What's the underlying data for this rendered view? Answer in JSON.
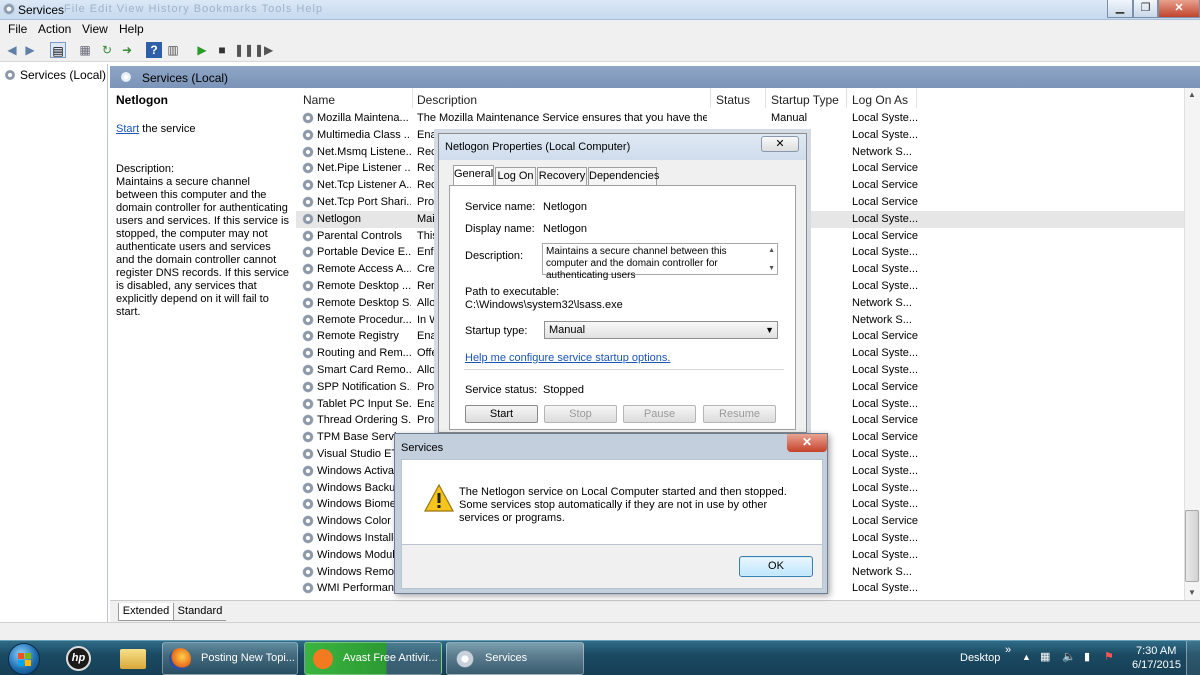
{
  "window": {
    "title": "Services",
    "ghost_menu": "File  Edit  View  History  Bookmarks  Tools  Help",
    "min": "▁",
    "max": "❐",
    "close": "✕"
  },
  "menu": [
    "File",
    "Action",
    "View",
    "Help"
  ],
  "tree": {
    "root": "Services (Local)"
  },
  "header": {
    "title": "Services (Local)"
  },
  "left_pane": {
    "service_name": "Netlogon",
    "start_link": "Start",
    "start_suffix": " the service",
    "desc_label": "Description:",
    "desc_text": "Maintains a secure channel between this computer and the domain controller for authenticating users and services. If this service is stopped, the computer may not authenticate users and services and the domain controller cannot register DNS records. If this service is disabled, any services that explicitly depend on it will fail to start."
  },
  "columns": {
    "name": "Name",
    "description": "Description",
    "status": "Status",
    "startup": "Startup Type",
    "logon": "Log On As"
  },
  "rows": [
    {
      "name": "Mozilla Maintena...",
      "desc": "The Mozilla Maintenance Service ensures that you have the l...",
      "status": "",
      "logon": "Local Syste...",
      "startup": "Manual"
    },
    {
      "name": "Multimedia Class ...",
      "desc": "Enab",
      "status": "",
      "logon": "Local Syste..."
    },
    {
      "name": "Net.Msmq Listene...",
      "desc": "Rece",
      "status": "",
      "logon": "Network S..."
    },
    {
      "name": "Net.Pipe Listener ...",
      "desc": "Rece",
      "status": "",
      "logon": "Local Service"
    },
    {
      "name": "Net.Tcp Listener A...",
      "desc": "Rece",
      "status": "",
      "logon": "Local Service"
    },
    {
      "name": "Net.Tcp Port Shari...",
      "desc": "Prov",
      "status": "",
      "logon": "Local Service"
    },
    {
      "name": "Netlogon",
      "desc": "Main",
      "status": "",
      "logon": "Local Syste...",
      "selected": true
    },
    {
      "name": "Parental Controls",
      "desc": "This",
      "status": "",
      "logon": "Local Service"
    },
    {
      "name": "Portable Device E...",
      "desc": "Enfo",
      "status": "",
      "logon": "Local Syste..."
    },
    {
      "name": "Remote Access A...",
      "desc": "Crea",
      "status": "",
      "logon": "Local Syste..."
    },
    {
      "name": "Remote Desktop ...",
      "desc": "Rem",
      "status": "",
      "logon": "Local Syste..."
    },
    {
      "name": "Remote Desktop S...",
      "desc": "Allo",
      "status": "",
      "logon": "Network S..."
    },
    {
      "name": "Remote Procedur...",
      "desc": "In W",
      "status": "",
      "logon": "Network S..."
    },
    {
      "name": "Remote Registry",
      "desc": "Enab",
      "status": "",
      "logon": "Local Service"
    },
    {
      "name": "Routing and Rem...",
      "desc": "Offe",
      "status": "",
      "logon": "Local Syste..."
    },
    {
      "name": "Smart Card Remo...",
      "desc": "Allo",
      "status": "",
      "logon": "Local Syste..."
    },
    {
      "name": "SPP Notification S...",
      "desc": "Prov",
      "status": "",
      "logon": "Local Service"
    },
    {
      "name": "Tablet PC Input Se...",
      "desc": "Enab",
      "status": "",
      "logon": "Local Syste..."
    },
    {
      "name": "Thread Ordering S...",
      "desc": "Prov",
      "status": "",
      "logon": "Local Service"
    },
    {
      "name": "TPM Base Service",
      "desc": "",
      "status": "",
      "logon": "Local Service"
    },
    {
      "name": "Visual Studio ETW",
      "desc": "",
      "status": "",
      "logon": "Local Syste..."
    },
    {
      "name": "Windows Activat",
      "desc": "",
      "status": "",
      "logon": "Local Syste..."
    },
    {
      "name": "Windows Backup",
      "desc": "",
      "status": "",
      "logon": "Local Syste..."
    },
    {
      "name": "Windows Biome",
      "desc": "",
      "status": "",
      "logon": "Local Syste..."
    },
    {
      "name": "Windows Color S",
      "desc": "",
      "status": "",
      "logon": "Local Service"
    },
    {
      "name": "Windows Installe",
      "desc": "",
      "status": "",
      "logon": "Local Syste..."
    },
    {
      "name": "Windows Modul",
      "desc": "",
      "status": "",
      "logon": "Local Syste..."
    },
    {
      "name": "Windows Remot",
      "desc": "",
      "status": "",
      "logon": "Network S..."
    },
    {
      "name": "WMI Performan",
      "desc": "",
      "status": "",
      "logon": "Local Syste..."
    }
  ],
  "bottom_tabs": {
    "extended": "Extended",
    "standard": "Standard"
  },
  "props_dialog": {
    "title": "Netlogon Properties (Local Computer)",
    "close": "✕",
    "tabs": [
      "General",
      "Log On",
      "Recovery",
      "Dependencies"
    ],
    "service_name_label": "Service name:",
    "service_name": "Netlogon",
    "display_name_label": "Display name:",
    "display_name": "Netlogon",
    "description_label": "Description:",
    "description": "Maintains a secure channel between this computer and the domain controller for authenticating users",
    "path_label": "Path to executable:",
    "path": "C:\\Windows\\system32\\lsass.exe",
    "startup_label": "Startup type:",
    "startup_value": "Manual",
    "help_link": "Help me configure service startup options.",
    "status_label": "Service status:",
    "status_value": "Stopped",
    "buttons": {
      "start": "Start",
      "stop": "Stop",
      "pause": "Pause",
      "resume": "Resume"
    }
  },
  "message_box": {
    "title": "Services",
    "close": "✕",
    "message": "The Netlogon service on Local Computer started and then stopped. Some services stop automatically if they are not in use by other services or programs.",
    "ok": "OK"
  },
  "taskbar": {
    "buttons": [
      "Posting New Topi...",
      "Avast Free Antivir...",
      "Services"
    ],
    "desktop_label": "Desktop",
    "expand": "»",
    "time": "7:30 AM",
    "date": "6/17/2015"
  }
}
